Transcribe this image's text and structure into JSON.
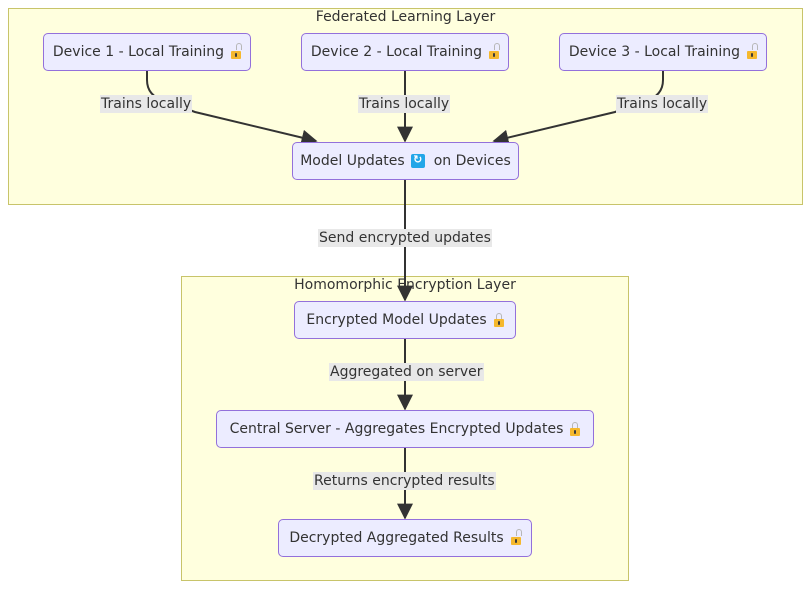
{
  "clusters": {
    "federated": {
      "title": "Federated Learning Layer"
    },
    "homomorphic": {
      "title": "Homomorphic Encryption Layer"
    }
  },
  "nodes": {
    "device1": {
      "label": "Device 1 - Local Training",
      "icon": "unlocked-lock-icon"
    },
    "device2": {
      "label": "Device 2 - Local Training",
      "icon": "unlocked-lock-icon"
    },
    "device3": {
      "label": "Device 3 - Local Training",
      "icon": "unlocked-lock-icon"
    },
    "model_updates": {
      "label_before": "Model Updates",
      "label_after": "on Devices",
      "icon": "sync-arrows-icon"
    },
    "encrypted_updates": {
      "label": "Encrypted Model Updates",
      "icon": "locked-lock-icon"
    },
    "central_server": {
      "label": "Central Server - Aggregates Encrypted Updates",
      "icon": "locked-lock-icon"
    },
    "decrypted_results": {
      "label": "Decrypted Aggregated Results",
      "icon": "unlocked-lock-icon"
    }
  },
  "edges": [
    {
      "from": "device1",
      "to": "model_updates",
      "label": "Trains locally"
    },
    {
      "from": "device2",
      "to": "model_updates",
      "label": "Trains locally"
    },
    {
      "from": "device3",
      "to": "model_updates",
      "label": "Trains locally"
    },
    {
      "from": "model_updates",
      "to": "encrypted_updates",
      "label": "Send encrypted updates"
    },
    {
      "from": "encrypted_updates",
      "to": "central_server",
      "label": "Aggregated on server"
    },
    {
      "from": "central_server",
      "to": "decrypted_results",
      "label": "Returns encrypted results"
    }
  ],
  "colors": {
    "cluster_fill": "#ffffde",
    "cluster_border": "#c8c46a",
    "node_fill": "#ececff",
    "node_border": "#9370db",
    "edge": "#333333",
    "edge_label_bg": "#e8e8e8"
  }
}
